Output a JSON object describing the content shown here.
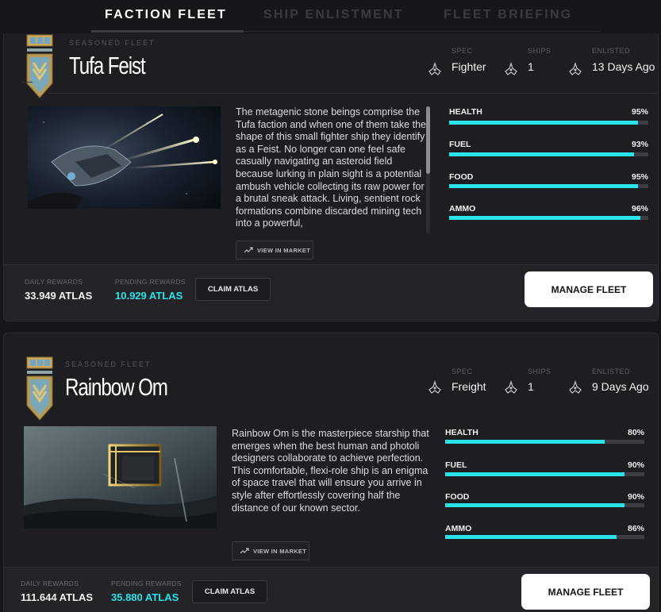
{
  "tabs": [
    "FACTION FLEET",
    "SHIP ENLISTMENT",
    "FLEET BRIEFING"
  ],
  "labels": {
    "spec": "SPEC",
    "ships": "SHIPS",
    "enlisted": "ENLISTED",
    "daily_rewards": "DAILY REWARDS",
    "pending_rewards": "PENDING REWARDS",
    "claim": "CLAIM ATLAS",
    "manage": "MANAGE FLEET",
    "market": "VIEW IN MARKET",
    "health": "HEALTH",
    "fuel": "FUEL",
    "food": "FOOD",
    "ammo": "AMMO"
  },
  "colors": {
    "accent": "#29e3e9",
    "card_bg": "#1e1e22",
    "footer_bg": "#242428"
  },
  "fleets": [
    {
      "tier": "SEASONED FLEET",
      "name": "Tufa Feist",
      "spec": "Fighter",
      "ships": "1",
      "enlisted": "13 Days Ago",
      "description": "The metagenic stone beings comprise the Tufa faction and when one of them take the shape of this small fighter ship they identify as a Feist. No longer can one feel safe casually navigating an asteroid field because lurking in plain sight is a potential ambush vehicle collecting its raw power for a brutal sneak attack. Living, sentient rock formations combine discarded mining tech into a powerful,",
      "stats": {
        "health": "95%",
        "fuel": "93%",
        "food": "95%",
        "ammo": "96%"
      },
      "stat_values": {
        "health": 0.95,
        "fuel": 0.93,
        "food": 0.95,
        "ammo": 0.96
      },
      "daily": "33.949 ATLAS",
      "pending": "10.929 ATLAS"
    },
    {
      "tier": "SEASONED FLEET",
      "name": "Rainbow Om",
      "spec": "Freight",
      "ships": "1",
      "enlisted": "9 Days Ago",
      "description": "Rainbow Om is the masterpiece starship that emerges when the best human and photoli designers collaborate to achieve perfection. This comfortable, flexi-role ship is an enigma of space travel that will ensure you arrive in style after effortlessly covering half the distance of our known sector.",
      "stats": {
        "health": "80%",
        "fuel": "90%",
        "food": "90%",
        "ammo": "86%"
      },
      "stat_values": {
        "health": 0.8,
        "fuel": 0.9,
        "food": 0.9,
        "ammo": 0.86
      },
      "daily": "111.644 ATLAS",
      "pending": "35.880 ATLAS"
    }
  ]
}
